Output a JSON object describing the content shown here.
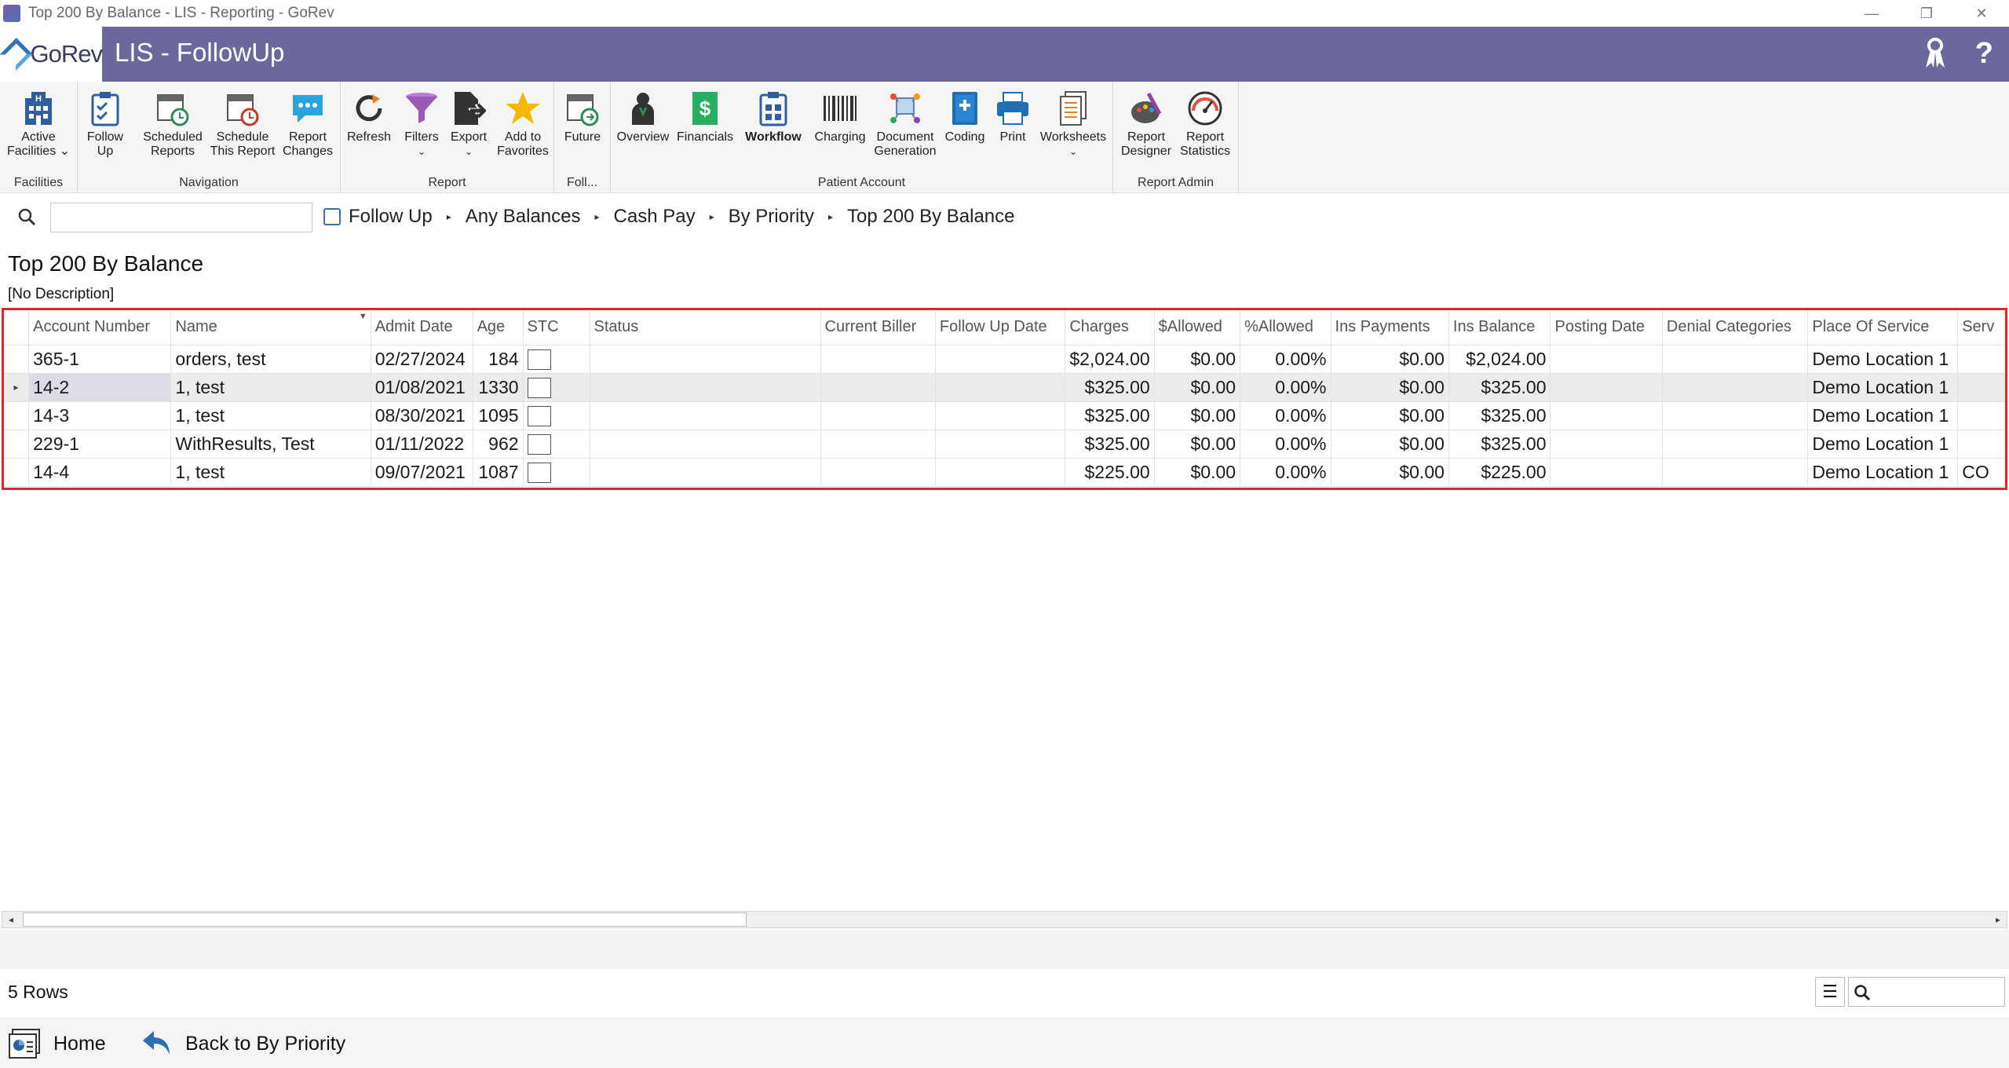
{
  "window": {
    "title": "Top 200 By Balance - LIS - Reporting - GoRev",
    "controls": [
      "—",
      "❐",
      "✕"
    ]
  },
  "header": {
    "logo_text": "GoRev",
    "app_title": "LIS - FollowUp",
    "icons": [
      "ribbon-icon",
      "help-icon"
    ],
    "help_label": "?"
  },
  "ribbon": {
    "groups": [
      {
        "label": "Facilities",
        "buttons": [
          {
            "label": "Active Facilities ⌄",
            "icon": "building-icon"
          }
        ]
      },
      {
        "label": "Navigation",
        "buttons": [
          {
            "label": "Follow Up",
            "icon": "clipboard-check-icon"
          },
          {
            "label": "Scheduled Reports",
            "icon": "calendar-clock-icon"
          },
          {
            "label": "Schedule This Report",
            "icon": "calendar-clock-red-icon"
          },
          {
            "label": "Report Changes",
            "icon": "chat-bubble-icon"
          }
        ]
      },
      {
        "label": "Report",
        "buttons": [
          {
            "label": "Refresh",
            "icon": "refresh-icon"
          },
          {
            "label": "Filters",
            "icon": "funnel-icon"
          },
          {
            "label": "Export",
            "icon": "export-icon"
          },
          {
            "label": "Add to Favorites",
            "icon": "star-icon"
          }
        ]
      },
      {
        "label": "Foll...",
        "buttons": [
          {
            "label": "Future",
            "icon": "calendar-future-icon"
          }
        ]
      },
      {
        "label": "Patient Account",
        "buttons": [
          {
            "label": "Overview",
            "icon": "person-icon"
          },
          {
            "label": "Financials",
            "icon": "dollar-icon"
          },
          {
            "label": "Workflow",
            "icon": "workflow-icon"
          },
          {
            "label": "Charging",
            "icon": "barcode-icon"
          },
          {
            "label": "Document Generation",
            "icon": "document-gen-icon"
          },
          {
            "label": "Coding",
            "icon": "coding-book-icon"
          },
          {
            "label": "Print",
            "icon": "printer-icon"
          },
          {
            "label": "Worksheets",
            "icon": "worksheets-icon"
          }
        ]
      },
      {
        "label": "Report Admin",
        "buttons": [
          {
            "label": "Report Designer",
            "icon": "palette-icon"
          },
          {
            "label": "Report Statistics",
            "icon": "gauge-icon"
          }
        ]
      }
    ]
  },
  "breadcrumb": {
    "search_value": "",
    "items": [
      "Follow Up",
      "Any Balances",
      "Cash Pay",
      "By Priority",
      "Top 200 By Balance"
    ]
  },
  "report": {
    "title": "Top 200 By Balance",
    "description": "[No Description]"
  },
  "grid": {
    "columns": [
      "Account Number",
      "Name",
      "Admit Date",
      "Age",
      "STC",
      "Status",
      "Current Biller",
      "Follow Up Date",
      "Charges",
      "$Allowed",
      "%Allowed",
      "Ins Payments",
      "Ins Balance",
      "Posting Date",
      "Denial Categories",
      "Place Of Service",
      "Serv"
    ],
    "rows": [
      {
        "account": "365-1",
        "name": "orders, test",
        "admit": "02/27/2024",
        "age": "184",
        "status": "",
        "biller": "",
        "followup": "",
        "charges": "$2,024.00",
        "allowed": "$0.00",
        "pct_allowed": "0.00%",
        "ins_payments": "$0.00",
        "ins_balance": "$2,024.00",
        "posting": "",
        "denial": "",
        "place": "Demo Location 1",
        "serv": ""
      },
      {
        "account": "14-2",
        "name": "1, test",
        "admit": "01/08/2021",
        "age": "1330",
        "status": "",
        "biller": "",
        "followup": "",
        "charges": "$325.00",
        "allowed": "$0.00",
        "pct_allowed": "0.00%",
        "ins_payments": "$0.00",
        "ins_balance": "$325.00",
        "posting": "",
        "denial": "",
        "place": "Demo Location 1",
        "serv": ""
      },
      {
        "account": "14-3",
        "name": "1, test",
        "admit": "08/30/2021",
        "age": "1095",
        "status": "",
        "biller": "",
        "followup": "",
        "charges": "$325.00",
        "allowed": "$0.00",
        "pct_allowed": "0.00%",
        "ins_payments": "$0.00",
        "ins_balance": "$325.00",
        "posting": "",
        "denial": "",
        "place": "Demo Location 1",
        "serv": ""
      },
      {
        "account": "229-1",
        "name": "WithResults, Test",
        "admit": "01/11/2022",
        "age": "962",
        "status": "",
        "biller": "",
        "followup": "",
        "charges": "$325.00",
        "allowed": "$0.00",
        "pct_allowed": "0.00%",
        "ins_payments": "$0.00",
        "ins_balance": "$325.00",
        "posting": "",
        "denial": "",
        "place": "Demo Location 1",
        "serv": ""
      },
      {
        "account": "14-4",
        "name": "1, test",
        "admit": "09/07/2021",
        "age": "1087",
        "status": "",
        "biller": "",
        "followup": "",
        "charges": "$225.00",
        "allowed": "$0.00",
        "pct_allowed": "0.00%",
        "ins_payments": "$0.00",
        "ins_balance": "$225.00",
        "posting": "",
        "denial": "",
        "place": "Demo Location 1",
        "serv": "CO"
      }
    ]
  },
  "status": {
    "rows_label": "5 Rows",
    "search_value": ""
  },
  "footer": {
    "home_label": "Home",
    "back_label": "Back to By Priority"
  },
  "colors": {
    "header_bg": "#6b699b",
    "highlight_border": "#e3262b",
    "selected_row": "#ececec"
  }
}
